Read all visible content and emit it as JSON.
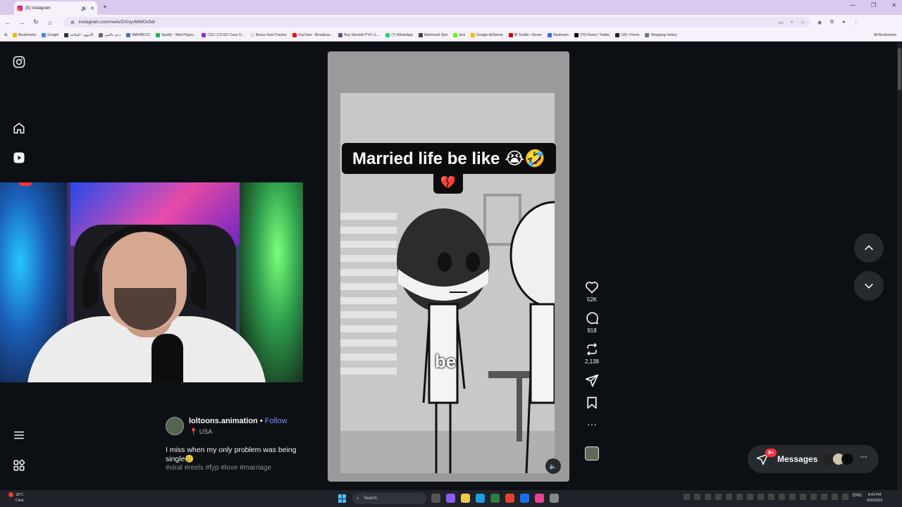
{
  "browser": {
    "tab_title": "(5) Instagram",
    "url": "instagram.com/reels/DXoyvMWOv5d/",
    "bookmarks": [
      "Bookmarks",
      "Google",
      "الأسهم - الملاحة",
      "دعم عالمي",
      "MAHRECO",
      "Spotify - Web Player...",
      "CS2 | CS:GO Case O...",
      "Bonus Hunt Tracker",
      "YouTube - Broadcas...",
      "Buy Steroids PVX LL...",
      "(7) WhatsApp",
      "Mahmoud Spin",
      "kick",
      "Google AdSense",
      "IB Toolkit • Server",
      "Restream",
      "(76) Home / Twitter",
      "100 • Home",
      "Shopping history"
    ],
    "all_bookmarks": "All Bookmarks",
    "accent": "#d9c9ef"
  },
  "reel": {
    "caption": "Married life be like 😭🤣",
    "caption_emoji": "💔",
    "subtitle": "be",
    "likes": "52K",
    "comments": "918",
    "reposts": "2,138"
  },
  "post": {
    "username": "loltoons.animation",
    "follow": "Follow",
    "separator": "•",
    "location": "USA",
    "description": "I miss when my only problem was being single🥲",
    "hashtags": "#viral #reels #fyp #love #marriage"
  },
  "messages": {
    "label": "Messages",
    "badge": "9+"
  },
  "taskbar": {
    "temp": "18°C",
    "weather": "Clear",
    "search": "Search",
    "lang": "ENG",
    "time": "8:43 PM",
    "date": "4/30/2026"
  },
  "colors": {
    "background": "#0c1014",
    "follow": "#7d8dff",
    "badge": "#ff3040"
  }
}
